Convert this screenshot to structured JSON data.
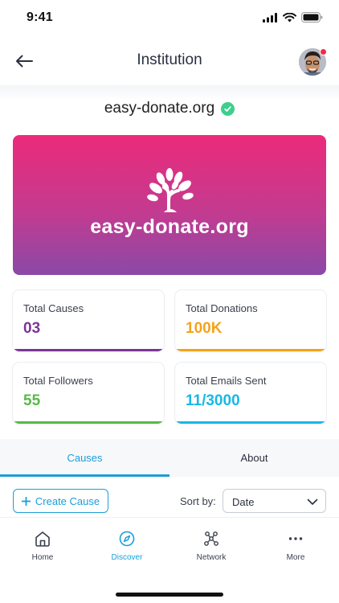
{
  "status_bar": {
    "time": "9:41"
  },
  "header": {
    "title": "Institution"
  },
  "org": {
    "name": "easy-donate.org",
    "banner_text": "easy-donate.org"
  },
  "stats": [
    {
      "label": "Total Causes",
      "value": "03",
      "color": "#7a3696",
      "bar_color": "#7a3696"
    },
    {
      "label": "Total Donations",
      "value": "100K",
      "color": "#f5a31a",
      "bar_color": "#f5a31a"
    },
    {
      "label": "Total Followers",
      "value": "55",
      "color": "#58b947",
      "bar_color": "#58b947"
    },
    {
      "label": "Total Emails Sent",
      "value": "11/3000",
      "color": "#18b8e6",
      "bar_color": "#18b8e6"
    }
  ],
  "tabs": [
    {
      "label": "Causes",
      "active": true
    },
    {
      "label": "About",
      "active": false
    }
  ],
  "toolbar": {
    "create_label": "Create Cause",
    "sort_label": "Sort by:",
    "sort_value": "Date"
  },
  "bottom_nav": [
    {
      "label": "Home",
      "icon": "home-icon",
      "active": false
    },
    {
      "label": "Discover",
      "icon": "compass-icon",
      "active": true
    },
    {
      "label": "Network",
      "icon": "network-icon",
      "active": false
    },
    {
      "label": "More",
      "icon": "more-dots-icon",
      "active": false
    }
  ],
  "colors": {
    "accent": "#1a9fd9",
    "verified": "#3ecf8e",
    "notification": "#ef2b4b"
  }
}
